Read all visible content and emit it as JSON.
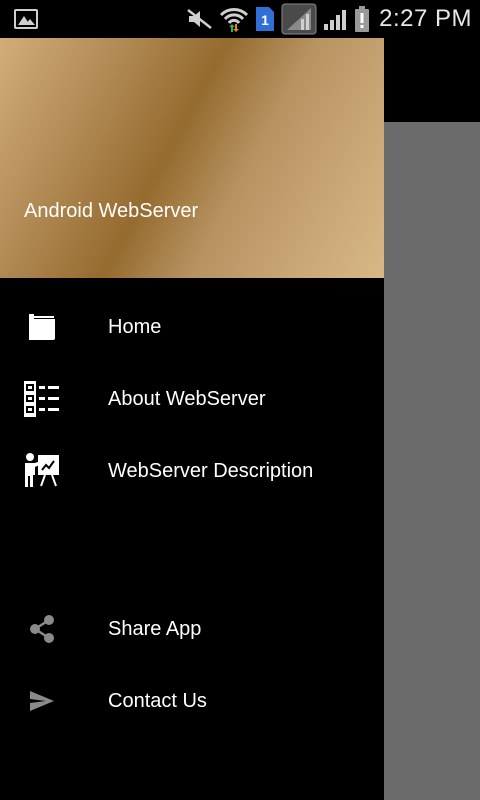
{
  "status_bar": {
    "time": "2:27 PM",
    "sim_badge": "1",
    "icons": [
      "image-icon",
      "mute-icon",
      "wifi-icon",
      "sim-icon",
      "signal-icon",
      "signal-icon",
      "battery-alert-icon"
    ]
  },
  "drawer": {
    "title": "Android WebServer",
    "header_colors": [
      "#d2ad7a",
      "#956b2f",
      "#d8b887"
    ],
    "items": [
      {
        "label": "Home",
        "icon": "home-card-icon"
      },
      {
        "label": "About WebServer",
        "icon": "checklist-icon"
      },
      {
        "label": "WebServer Description",
        "icon": "presentation-icon"
      }
    ],
    "secondary_items": [
      {
        "label": "Share App",
        "icon": "share-icon"
      },
      {
        "label": "Contact Us",
        "icon": "send-icon"
      }
    ]
  },
  "colors": {
    "scrim": "#6b6b6b",
    "drawer_background": "#000000"
  }
}
